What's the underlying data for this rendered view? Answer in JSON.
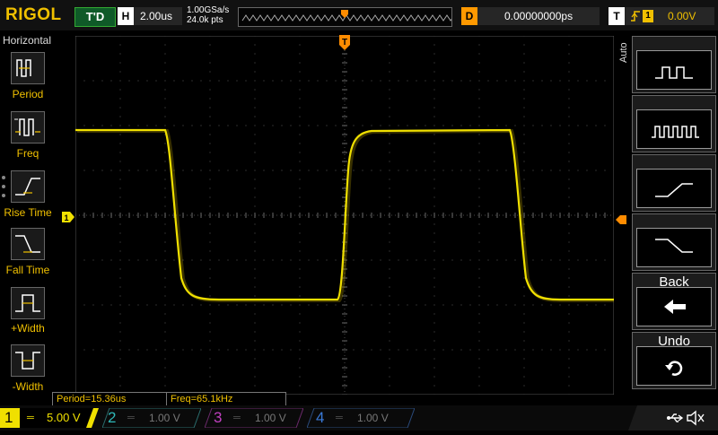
{
  "brand": "RIGOL",
  "status": "T'D",
  "timebase": {
    "label": "H",
    "value": "2.00us"
  },
  "acquisition": {
    "sample_rate": "1.00GSa/s",
    "memory_depth": "24.0k pts"
  },
  "delay": {
    "label": "D",
    "value": "0.00000000ps"
  },
  "trigger": {
    "label": "T",
    "edge_icon": "rising-edge-icon",
    "source": "1",
    "level": "0.00V"
  },
  "left_menu": {
    "title": "Horizontal",
    "items": [
      "Period",
      "Freq",
      "Rise Time",
      "Fall Time",
      "+Width",
      "-Width"
    ]
  },
  "right_menu": {
    "auto_label": "Auto",
    "back_label": "Back",
    "undo_label": "Undo"
  },
  "measurements": [
    {
      "text": "Period=15.36us"
    },
    {
      "text": "Freq=65.1kHz"
    }
  ],
  "channels": [
    {
      "num": "1",
      "scale": "5.00 V",
      "color": "#f0e000",
      "active": true
    },
    {
      "num": "2",
      "scale": "1.00 V",
      "color": "#2fb8b8",
      "active": false
    },
    {
      "num": "3",
      "scale": "1.00 V",
      "color": "#c040c0",
      "active": false
    },
    {
      "num": "4",
      "scale": "1.00 V",
      "color": "#3a7ad8",
      "active": false
    }
  ],
  "markers": {
    "trigger_pos": "T",
    "ch1_marker": "1"
  },
  "colors": {
    "trace": "#f0e000",
    "accent": "#f0c000",
    "trigger_marker": "#ff8c00"
  }
}
